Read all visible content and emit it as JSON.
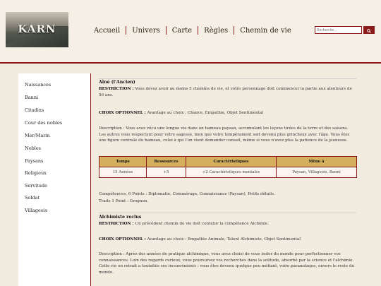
{
  "logo": {
    "text": "KARN"
  },
  "nav": {
    "items": [
      "Accueil",
      "Univers",
      "Carte",
      "Règles",
      "Chemin de vie"
    ]
  },
  "search": {
    "placeholder": "Recherche..."
  },
  "sidebar": {
    "items": [
      "Naissances",
      "Banni",
      "Citadins",
      "Cour des nobles",
      "Mer/Marin",
      "Nobles",
      "Paysans",
      "Religieux",
      "Servitude",
      "Soldat",
      "Villageois"
    ]
  },
  "section1": {
    "title": "Aîné (l'Ancien)",
    "restriction_label": "RESTRICTION :",
    "restriction": " Vous devez avoir au moins 5 chemins de vie, et votre personnage doit commencer la partie aux alentours de 50 ans.",
    "choice_label": "CHOIX OPTIONNEL :",
    "choice": " Avantage au choix : Chance, Empathie, Objet Sentimental",
    "description": "Description : Vous avez vécu une longue vie dans un hameau paysan, accumulant les leçons tirées de la terre et des saisons. Les autres vous respectent pour votre sagesse, bien que votre tempérament soit devenu plus grincheux avec l'âge. Vous êtes une figure centrale du hameau, celui à qui l'on vient demander conseil, même si vous n'avez plus la patience de la jeunesse.",
    "table": {
      "headers": [
        "Temps",
        "Ressources",
        "Caractéristiques",
        "Mène à"
      ],
      "row": [
        "15 Années",
        "+5",
        "+2 Caractéristiques mentales",
        "Paysan, Villageois, Banni"
      ]
    },
    "skills": "Compétences, 6 Points : Diplomatie, Commérage, Connaissance (Paysan), Petits détails.",
    "traits": "Traits 1 Point : Grognon."
  },
  "section2": {
    "title": "Alchimiste reclus",
    "restriction_label": "RESTRICTION :",
    "restriction": " Un précédent chemin de vie doit contenir la compétence Alchimie.",
    "choice_label": "CHOIX OPTIONNEL :",
    "choice": " Avantage au choix : Empathie Animale, Talent Alchimiste, Objet Sentimental",
    "description": "Description : Après des années de pratique alchimique, vous avez choisi de vous isoler du monde pour perfectionner vos connaissances. Loin des regards curieux, vous poursuivez vos recherches dans la solitude, absorbé par la science et l'alchimie. Cette vie en retrait a toutefois ses inconvénients : vous êtes devenu quelque peu méfiant, voire paranoïaque, envers le reste du monde."
  }
}
